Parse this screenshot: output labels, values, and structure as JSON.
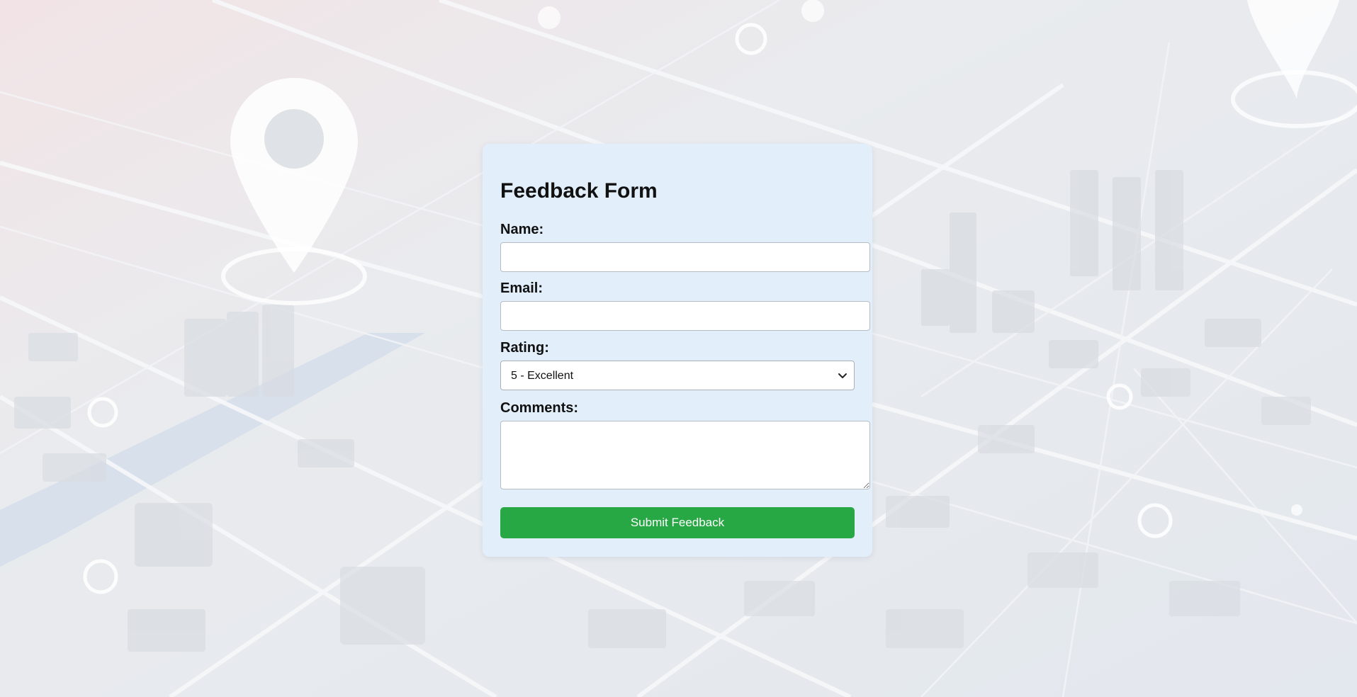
{
  "form": {
    "title": "Feedback Form",
    "name_label": "Name:",
    "name_value": "",
    "email_label": "Email:",
    "email_value": "",
    "rating_label": "Rating:",
    "rating_selected": "5 - Excellent",
    "comments_label": "Comments:",
    "comments_value": "",
    "submit_label": "Submit Feedback"
  },
  "icons": {
    "rating_dropdown": "chevron-down-icon",
    "background_pins": "map-pin-icon"
  },
  "colors": {
    "card_background": "#e2effa",
    "submit_button": "#28a745",
    "submit_text": "#ffffff"
  }
}
